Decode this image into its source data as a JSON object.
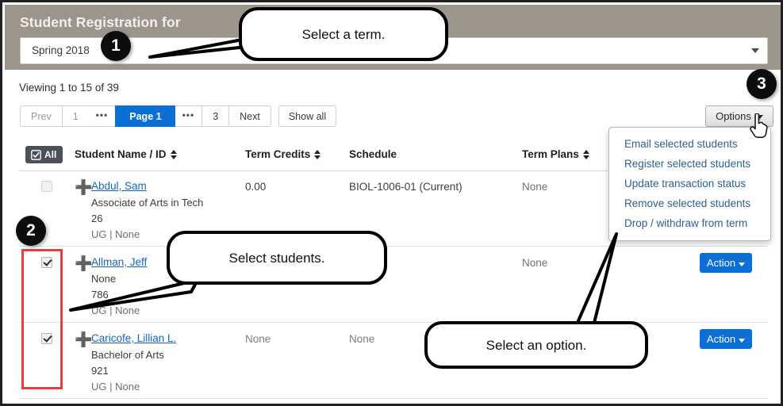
{
  "header": {
    "title": "Student Registration for",
    "term_select": {
      "value": "Spring 2018",
      "caret_icon": "chevron-down-icon"
    },
    "background_color": "#9b958c"
  },
  "toolbar": {
    "viewing_text": "Viewing 1 to 15 of 39",
    "pagination": {
      "prev_label": "Prev",
      "first_page_label": "1",
      "ellipsis_left": "•••",
      "current_page_label": "Page 1",
      "ellipsis_right": "•••",
      "last_page_label": "3",
      "next_label": "Next",
      "show_all_label": "Show all",
      "active_color": "#0b6fd4"
    },
    "options_button": {
      "label": "Options",
      "caret_icon": "caret-down-icon"
    }
  },
  "dropdown": {
    "items": [
      {
        "label": "Email selected students"
      },
      {
        "label": "Register selected students"
      },
      {
        "label": "Update transaction status"
      },
      {
        "label": "Remove selected students"
      },
      {
        "label": "Drop / withdraw from term"
      }
    ],
    "link_color": "#2f5f8f"
  },
  "table": {
    "select_all": {
      "label": "All",
      "icon": "check-square-icon"
    },
    "columns": [
      {
        "label": "Student Name / ID",
        "sortable": true
      },
      {
        "label": "Term Credits",
        "sortable": true
      },
      {
        "label": "Schedule",
        "sortable": false
      },
      {
        "label": "Term Plans",
        "sortable": true
      }
    ],
    "rows": [
      {
        "checked": false,
        "expand_icon": "plus-icon",
        "name": "Abdul, Sam",
        "program": "Associate of Arts in Tech",
        "id": "26",
        "meta": "UG | None",
        "term_credits": "0.00",
        "schedule": "BIOL-1006-01 (Current)",
        "term_plans": "None",
        "action_label": "",
        "has_action": false
      },
      {
        "checked": true,
        "expand_icon": "plus-icon",
        "name": "Allman, Jeff",
        "program": "None",
        "id": "786",
        "meta": "UG | None",
        "term_credits": "",
        "schedule": "",
        "term_plans": "None",
        "action_label": "Action",
        "has_action": true
      },
      {
        "checked": true,
        "expand_icon": "plus-icon",
        "name": "Caricofe, Lillian L.",
        "program": "Bachelor of Arts",
        "id": "921",
        "meta": "UG | None",
        "term_credits": "None",
        "schedule": "None",
        "term_plans": "",
        "action_label": "Action",
        "has_action": true
      }
    ],
    "action_button_color": "#0b6fd4",
    "link_color": "#1565c0"
  },
  "annotations": {
    "badges": [
      {
        "number": "1"
      },
      {
        "number": "2"
      },
      {
        "number": "3"
      }
    ],
    "callouts": [
      {
        "text": "Select a term."
      },
      {
        "text": "Select students."
      },
      {
        "text": "Select an option."
      }
    ],
    "highlight_box_color": "#ef3b3b"
  }
}
